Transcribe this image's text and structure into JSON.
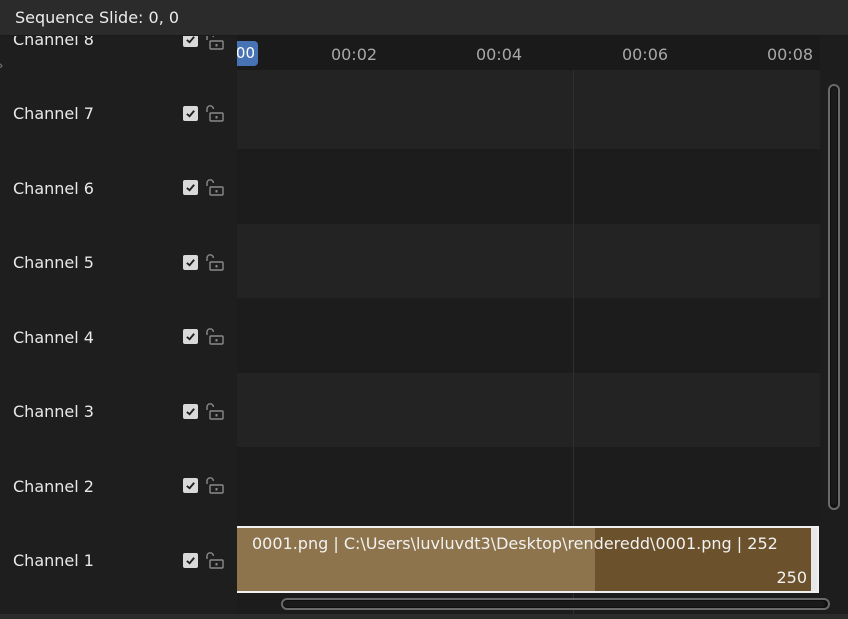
{
  "header": {
    "status_text": "Sequence Slide: 0, 0"
  },
  "channels": [
    {
      "label": "Channel 8"
    },
    {
      "label": "Channel 7"
    },
    {
      "label": "Channel 6"
    },
    {
      "label": "Channel 5"
    },
    {
      "label": "Channel 4"
    },
    {
      "label": "Channel 3"
    },
    {
      "label": "Channel 2"
    },
    {
      "label": "Channel 1"
    }
  ],
  "ruler": {
    "current_frame": "00",
    "ticks": [
      "00:02",
      "00:04",
      "00:06",
      "00:08"
    ]
  },
  "strip": {
    "label": "0001.png | C:\\Users\\luvluvdt3\\Desktop\\renderedd\\0001.png | 252",
    "length": "250",
    "color": "#8d744d"
  },
  "colors": {
    "accent": "#4772b3",
    "strip_dark": "#6b512c"
  }
}
